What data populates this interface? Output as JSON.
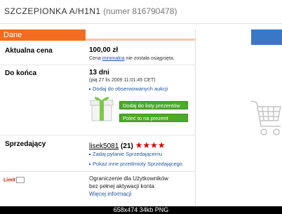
{
  "title": {
    "main": "SZCZEPIONKA A/H1N1",
    "sub": "(numer 816790478)"
  },
  "section_header": "Dane",
  "price": {
    "label": "Aktualna cena",
    "value": "100,00 zł",
    "note_prefix": "Cena",
    "note_link": "minimalna",
    "note_suffix": "nie została osiągnięta."
  },
  "ending": {
    "label": "Do końca",
    "value": "13 dni",
    "date": "(pią 27 lis 2009 11:01:45 CET)",
    "watch_link": "Dodaj do obserwowanych aukcji"
  },
  "gift": {
    "btn_list": "Dodaj do listy prezentów",
    "btn_recommend": "Poleć to na prezent"
  },
  "seller": {
    "label": "Sprzedający",
    "name": "lisek5081",
    "rating": "(21)",
    "stars": "★★★★",
    "link_ask": "Zadaj pytanie Sprzedającemu",
    "link_items": "Pokaż inne przedmioty Sprzedającego"
  },
  "limit": {
    "logo_text": "Limit",
    "line1": "Ograniczenie dla Użytkowników",
    "line2": "bez pełnej aktywacji konta",
    "more": "Więcej informacji"
  },
  "footer": "658x474 34kb PNG"
}
